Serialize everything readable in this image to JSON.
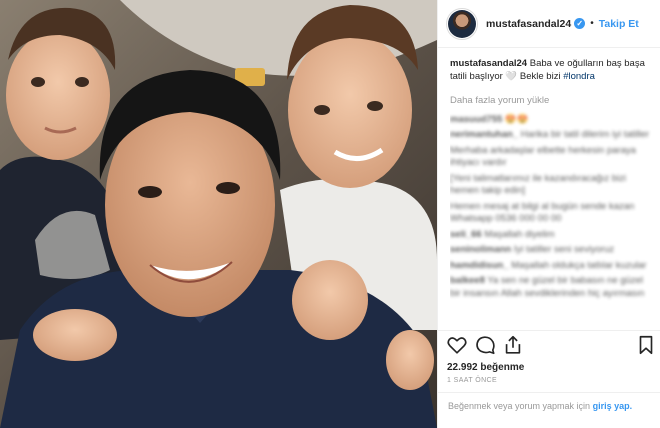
{
  "post": {
    "username": "mustafasandal24",
    "follow_label": "Takip Et",
    "separator": "•",
    "verified_glyph": "✓",
    "caption_user": "mustafasandal24",
    "caption_text": "Baba ve oğulların baş başa tatili başlıyor 🤍 Bekle bizi",
    "caption_tag": "#londra",
    "load_more": "Daha fazla yorum yükle"
  },
  "comments": [
    {
      "user": "masuud755",
      "text": "😍😍"
    },
    {
      "user": "nerimantuhan_",
      "text": "Harika bir tatil dilerim iyi tatiller"
    },
    {
      "user": "",
      "text": "Merhaba arkadaşlar elbette herkesin paraya ihtiyacı vardır"
    },
    {
      "user": "",
      "text": "[Yeni talimatlarımız ile kazandıracağız bizi hemen takip edin]"
    },
    {
      "user": "",
      "text": "Hemen mesaj at bilgi al bugün sende kazan Whatsapp 0536 000 00 00"
    },
    {
      "user": "seli_66",
      "text": "Maşallah diyelim"
    },
    {
      "user": "seninolimann",
      "text": "Iyi tatiller seni seviyoruz"
    },
    {
      "user": "hamdidisun_",
      "text": "Maşallah oldukça tatlılar kuzular"
    },
    {
      "user": "balkee8",
      "text": "Ya sen ne güzel bir babasın ne güzel bir insansın Allah sevdiklerinden hiç ayırmasın"
    }
  ],
  "actions": {
    "heart_icon": "heart-icon",
    "comment_icon": "comment-icon",
    "share_icon": "share-icon",
    "bookmark_icon": "bookmark-icon"
  },
  "likes": "22.992 beğenme",
  "time_ago": "1 SAAT ÖNCE",
  "login_prompt": {
    "text": "Beğenmek veya yorum yapmak için",
    "link": "giriş yap."
  },
  "colors": {
    "accent": "#3897f0",
    "text": "#262626",
    "muted": "#999999",
    "divider": "#efefef"
  }
}
